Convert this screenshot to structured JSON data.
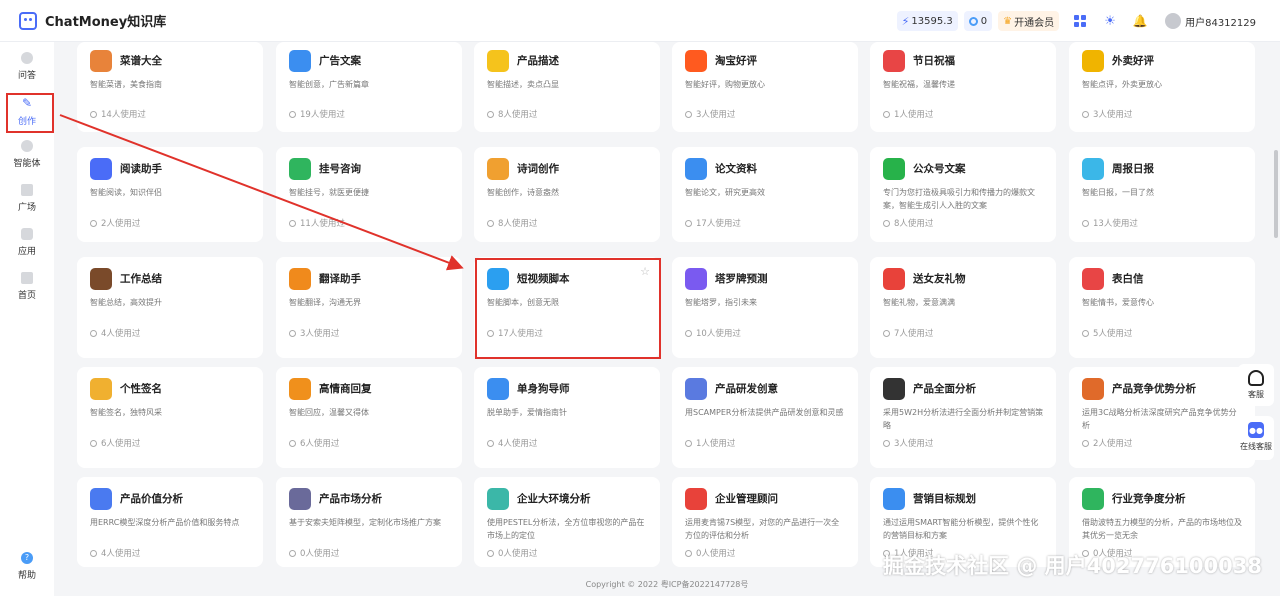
{
  "header": {
    "app_title": "ChatMoney知识库",
    "power": "13595.3",
    "coins": "0",
    "vip_label": "开通会员",
    "user_name": "用户84312129"
  },
  "sidebar": {
    "items": [
      {
        "label": "问答"
      },
      {
        "label": "创作"
      },
      {
        "label": "智能体"
      },
      {
        "label": "广场"
      },
      {
        "label": "应用"
      },
      {
        "label": "首页"
      }
    ],
    "help_label": "帮助"
  },
  "cards": [
    {
      "title": "菜谱大全",
      "desc": "智能菜谱，美食指南",
      "uses": "14人使用过",
      "icon": "cookbook-icon",
      "color": "#e8833a"
    },
    {
      "title": "广告文案",
      "desc": "智能创意，广告新篇章",
      "uses": "19人使用过",
      "icon": "megaphone-icon",
      "color": "#3b8ef0"
    },
    {
      "title": "产品描述",
      "desc": "智能描述，卖点凸显",
      "uses": "8人使用过",
      "icon": "shopping-bag-icon",
      "color": "#f5c31c"
    },
    {
      "title": "淘宝好评",
      "desc": "智能好评，购物更放心",
      "uses": "3人使用过",
      "icon": "taobao-icon",
      "color": "#ff5a1f"
    },
    {
      "title": "节日祝福",
      "desc": "智能祝福，温馨传递",
      "uses": "1人使用过",
      "icon": "calendar-icon",
      "color": "#e84545"
    },
    {
      "title": "外卖好评",
      "desc": "智能点评，外卖更放心",
      "uses": "3人使用过",
      "icon": "thumbs-up-icon",
      "color": "#f0b400"
    },
    {
      "title": "阅读助手",
      "desc": "智能阅读，知识伴侣",
      "uses": "2人使用过",
      "icon": "books-icon",
      "color": "#4a6cf7"
    },
    {
      "title": "挂号咨询",
      "desc": "智能挂号，就医更便捷",
      "uses": "11人使用过",
      "icon": "hospital-icon",
      "color": "#2fb55e"
    },
    {
      "title": "诗词创作",
      "desc": "智能创作，诗意盎然",
      "uses": "8人使用过",
      "icon": "open-book-icon",
      "color": "#f0a030"
    },
    {
      "title": "论文资料",
      "desc": "智能论文，研究更高效",
      "uses": "17人使用过",
      "icon": "binders-icon",
      "color": "#3b8ef0"
    },
    {
      "title": "公众号文案",
      "desc": "专门为您打造极具吸引力和传播力的爆款文案，智能生成引人入胜的文案",
      "uses": "8人使用过",
      "icon": "wechat-icon",
      "color": "#27b24a"
    },
    {
      "title": "周报日报",
      "desc": "智能日报，一目了然",
      "uses": "13人使用过",
      "icon": "report-icon",
      "color": "#3bb7e8"
    },
    {
      "title": "工作总结",
      "desc": "智能总结，高效提升",
      "uses": "4人使用过",
      "icon": "briefcase-icon",
      "color": "#7a4a2a"
    },
    {
      "title": "翻译助手",
      "desc": "智能翻译，沟通无界",
      "uses": "3人使用过",
      "icon": "translate-icon",
      "color": "#f08a1c"
    },
    {
      "title": "短视频脚本",
      "desc": "智能脚本，创意无限",
      "uses": "17人使用过",
      "icon": "clapperboard-icon",
      "color": "#2b9ff0"
    },
    {
      "title": "塔罗牌预测",
      "desc": "智能塔罗，指引未来",
      "uses": "10人使用过",
      "icon": "tarot-star-icon",
      "color": "#7a5af0"
    },
    {
      "title": "送女友礼物",
      "desc": "智能礼物，爱意满满",
      "uses": "7人使用过",
      "icon": "gift-icon",
      "color": "#e8423a"
    },
    {
      "title": "表白信",
      "desc": "智能情书，爱意传心",
      "uses": "5人使用过",
      "icon": "love-letter-icon",
      "color": "#e84545"
    },
    {
      "title": "个性签名",
      "desc": "智能签名，独特风采",
      "uses": "6人使用过",
      "icon": "pencil-icon",
      "color": "#f0b030"
    },
    {
      "title": "高情商回复",
      "desc": "智能回应，温馨又得体",
      "uses": "6人使用过",
      "icon": "chat-bubble-icon",
      "color": "#f0901c"
    },
    {
      "title": "单身狗导师",
      "desc": "脱单助手，爱情指南针",
      "uses": "4人使用过",
      "icon": "mentor-icon",
      "color": "#3b8ef0"
    },
    {
      "title": "产品研发创意",
      "desc": "用SCAMPER分析法提供产品研发创意和灵感",
      "uses": "1人使用过",
      "icon": "engineer-icon",
      "color": "#5a7ae0"
    },
    {
      "title": "产品全面分析",
      "desc": "采用5W2H分析法进行全面分析并制定营销策略",
      "uses": "3人使用过",
      "icon": "analysis-icon",
      "color": "#333333"
    },
    {
      "title": "产品竞争优势分析",
      "desc": "运用3C战略分析法深度研究产品竞争优势分析",
      "uses": "2人使用过",
      "icon": "presentation-icon",
      "color": "#e06a2a"
    },
    {
      "title": "产品价值分析",
      "desc": "用ERRC模型深度分析产品价值和服务特点",
      "uses": "4人使用过",
      "icon": "value-icon",
      "color": "#4a7af0"
    },
    {
      "title": "产品市场分析",
      "desc": "基于安索夫矩阵模型，定制化市场推广方案",
      "uses": "0人使用过",
      "icon": "market-icon",
      "color": "#6a6a9a"
    },
    {
      "title": "企业大环境分析",
      "desc": "使用PESTEL分析法，全方位审视您的产品在市场上的定位",
      "uses": "0人使用过",
      "icon": "environment-icon",
      "color": "#3bb7a8"
    },
    {
      "title": "企业管理顾问",
      "desc": "运用麦肯锡7S模型，对您的产品进行一次全方位的评估和分析",
      "uses": "0人使用过",
      "icon": "consultant-icon",
      "color": "#e8423a"
    },
    {
      "title": "营销目标规划",
      "desc": "通过运用SMART智能分析模型，提供个性化的营销目标和方案",
      "uses": "1人使用过",
      "icon": "plan-icon",
      "color": "#3b8ef0"
    },
    {
      "title": "行业竞争度分析",
      "desc": "借助波特五力模型的分析，产品的市场地位及其优劣一览无余",
      "uses": "0人使用过",
      "icon": "competition-icon",
      "color": "#2fb55e"
    }
  ],
  "float": {
    "service_label": "客服",
    "online_label": "在线客服"
  },
  "footer": "Copyright © 2022 粤ICP备2022147728号",
  "watermark": "掘金技术社区 @ 用户402776100038"
}
